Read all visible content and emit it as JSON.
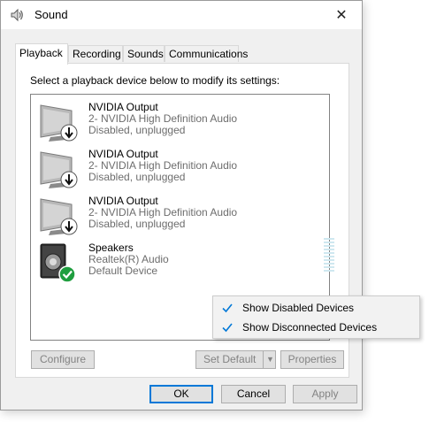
{
  "window": {
    "title": "Sound",
    "close_glyph": "✕"
  },
  "tabs": [
    {
      "label": "Playback",
      "active": true
    },
    {
      "label": "Recording",
      "active": false
    },
    {
      "label": "Sounds",
      "active": false
    },
    {
      "label": "Communications",
      "active": false
    }
  ],
  "instruction": "Select a playback device below to modify its settings:",
  "devices": [
    {
      "name": "NVIDIA Output",
      "description": "2- NVIDIA High Definition Audio",
      "status": "Disabled, unplugged",
      "icon": "monitor-icon",
      "badge": "down-arrow-badge-icon"
    },
    {
      "name": "NVIDIA Output",
      "description": "2- NVIDIA High Definition Audio",
      "status": "Disabled, unplugged",
      "icon": "monitor-icon",
      "badge": "down-arrow-badge-icon"
    },
    {
      "name": "NVIDIA Output",
      "description": "2- NVIDIA High Definition Audio",
      "status": "Disabled, unplugged",
      "icon": "monitor-icon",
      "badge": "down-arrow-badge-icon"
    },
    {
      "name": "Speakers",
      "description": "Realtek(R) Audio",
      "status": "Default Device",
      "icon": "speaker-icon",
      "badge": "green-check-badge-icon"
    }
  ],
  "panel_buttons": {
    "configure": "Configure",
    "set_default": "Set Default",
    "set_default_arrow": "▼",
    "properties": "Properties"
  },
  "context_menu": [
    {
      "label": "Show Disabled Devices",
      "checked": true
    },
    {
      "label": "Show Disconnected Devices",
      "checked": true
    }
  ],
  "dialog_buttons": {
    "ok": "OK",
    "cancel": "Cancel",
    "apply": "Apply"
  },
  "colors": {
    "accent": "#0078d7",
    "check": "#0078d7",
    "badge_green": "#1f9e3f",
    "disabled_text": "#838383"
  }
}
